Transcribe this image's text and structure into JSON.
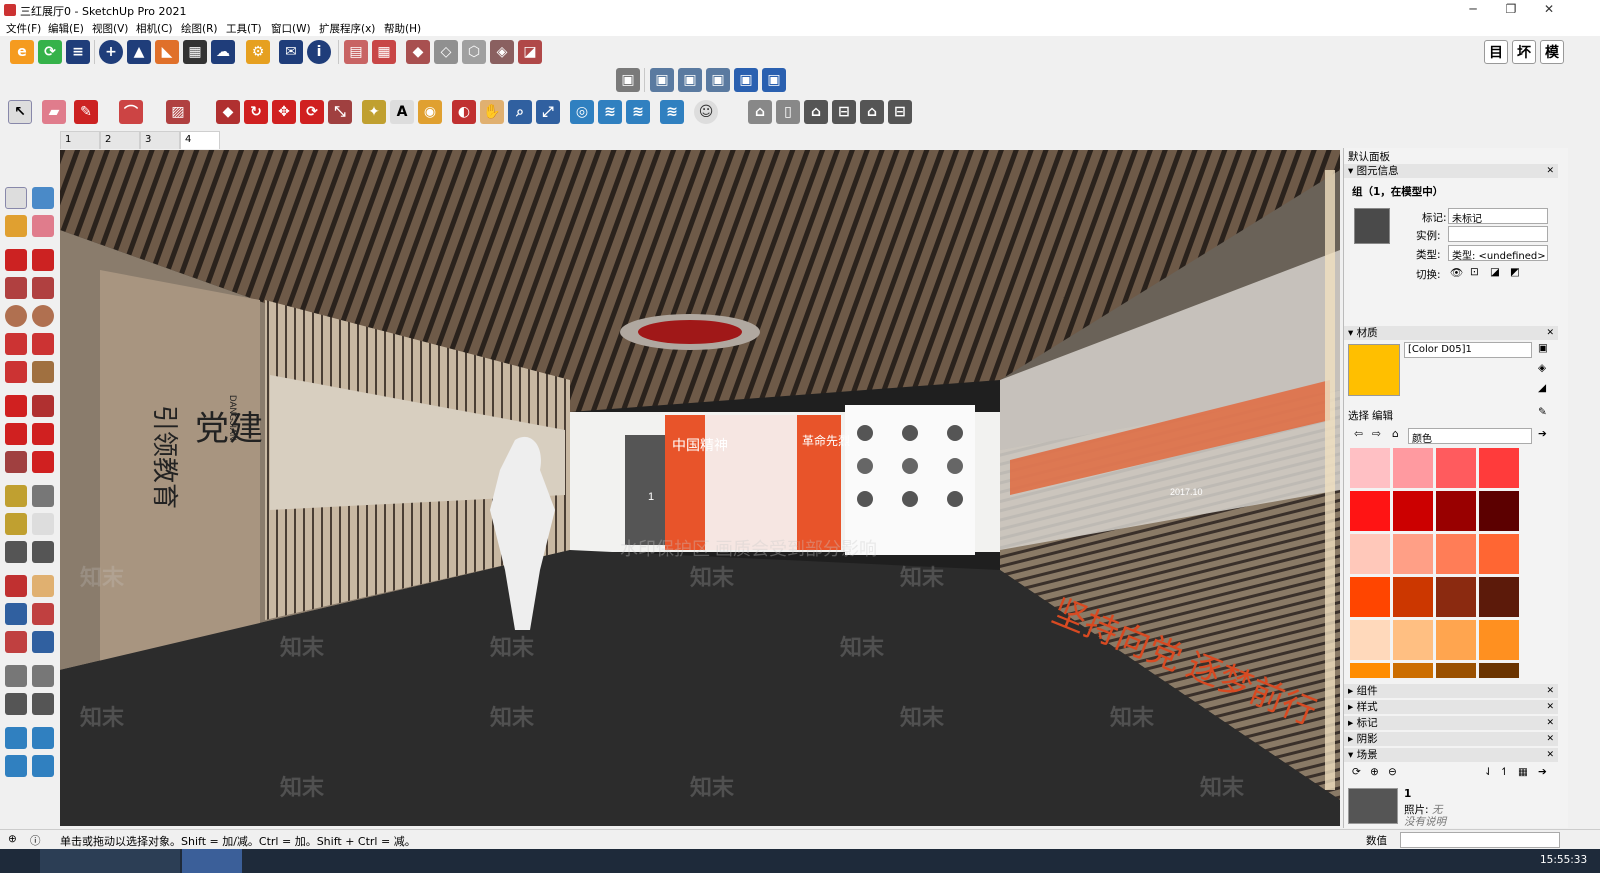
{
  "window": {
    "title": "三红展厅0 - SketchUp Pro 2021",
    "minimize": "─",
    "maximize": "❐",
    "close": "✕"
  },
  "menu": [
    "文件(F)",
    "编辑(E)",
    "视图(V)",
    "相机(C)",
    "绘图(R)",
    "工具(T)",
    "窗口(W)",
    "扩展程序(x)",
    "帮助(H)"
  ],
  "top_right_tools": [
    "目",
    "坏",
    "模"
  ],
  "scene_tabs": [
    "1",
    "2",
    "3",
    "4"
  ],
  "active_scene_tab": "4",
  "viewport": {
    "wall_sign_line1": "引领教育",
    "wall_sign_line2": "党建",
    "wall_sign_sub": "DANGJIAN",
    "panel_red1": "中国精神",
    "panel_red2": "革命先烈",
    "door_number": "1",
    "red_slogan": "坚持向党 逐梦前行",
    "watermark_notice": "水印保护区  画质会受到部分影响",
    "watermark": "知末",
    "wall_year": "2017.10"
  },
  "default_tray": {
    "title": "默认面板",
    "entity_info": {
      "header": "图元信息",
      "selection": "组（1，在模型中）",
      "tag_label": "标记:",
      "tag_value": "未标记",
      "instance_label": "实例:",
      "instance_value": "",
      "type_label": "类型:",
      "type_value": "类型: <undefined>",
      "toggles_label": "切换:"
    },
    "materials": {
      "header": "材质",
      "name": "[Color D05]1",
      "current_color": "#ffbf00",
      "select_tab": "选择",
      "edit_tab": "编辑",
      "library": "颜色",
      "swatches": [
        "#ffc0c4",
        "#ff9aa0",
        "#ff5b5e",
        "#ff3b3b",
        "#ff1414",
        "#cc0000",
        "#990000",
        "#5c0000",
        "#ffc8ba",
        "#ff9f86",
        "#ff7d57",
        "#ff6633",
        "#ff4500",
        "#cc3700",
        "#8b2a10",
        "#5c1a0a",
        "#ffd9bb",
        "#ffbf82",
        "#ffa54f",
        "#ff9020",
        "#ff8c00",
        "#cc6d00",
        "#9a5000",
        "#6b3400"
      ]
    },
    "collapsed": [
      "组件",
      "样式",
      "标记",
      "阴影",
      "场景"
    ],
    "scenes": {
      "name": "1",
      "photo_label": "照片:",
      "photo_value": "无",
      "description": "没有说明"
    }
  },
  "status": {
    "message": "单击或拖动以选择对象。Shift = 加/减。Ctrl = 加。Shift + Ctrl = 减。",
    "measurements_label": "数值"
  },
  "taskbar": {
    "time": "15:55:33"
  }
}
